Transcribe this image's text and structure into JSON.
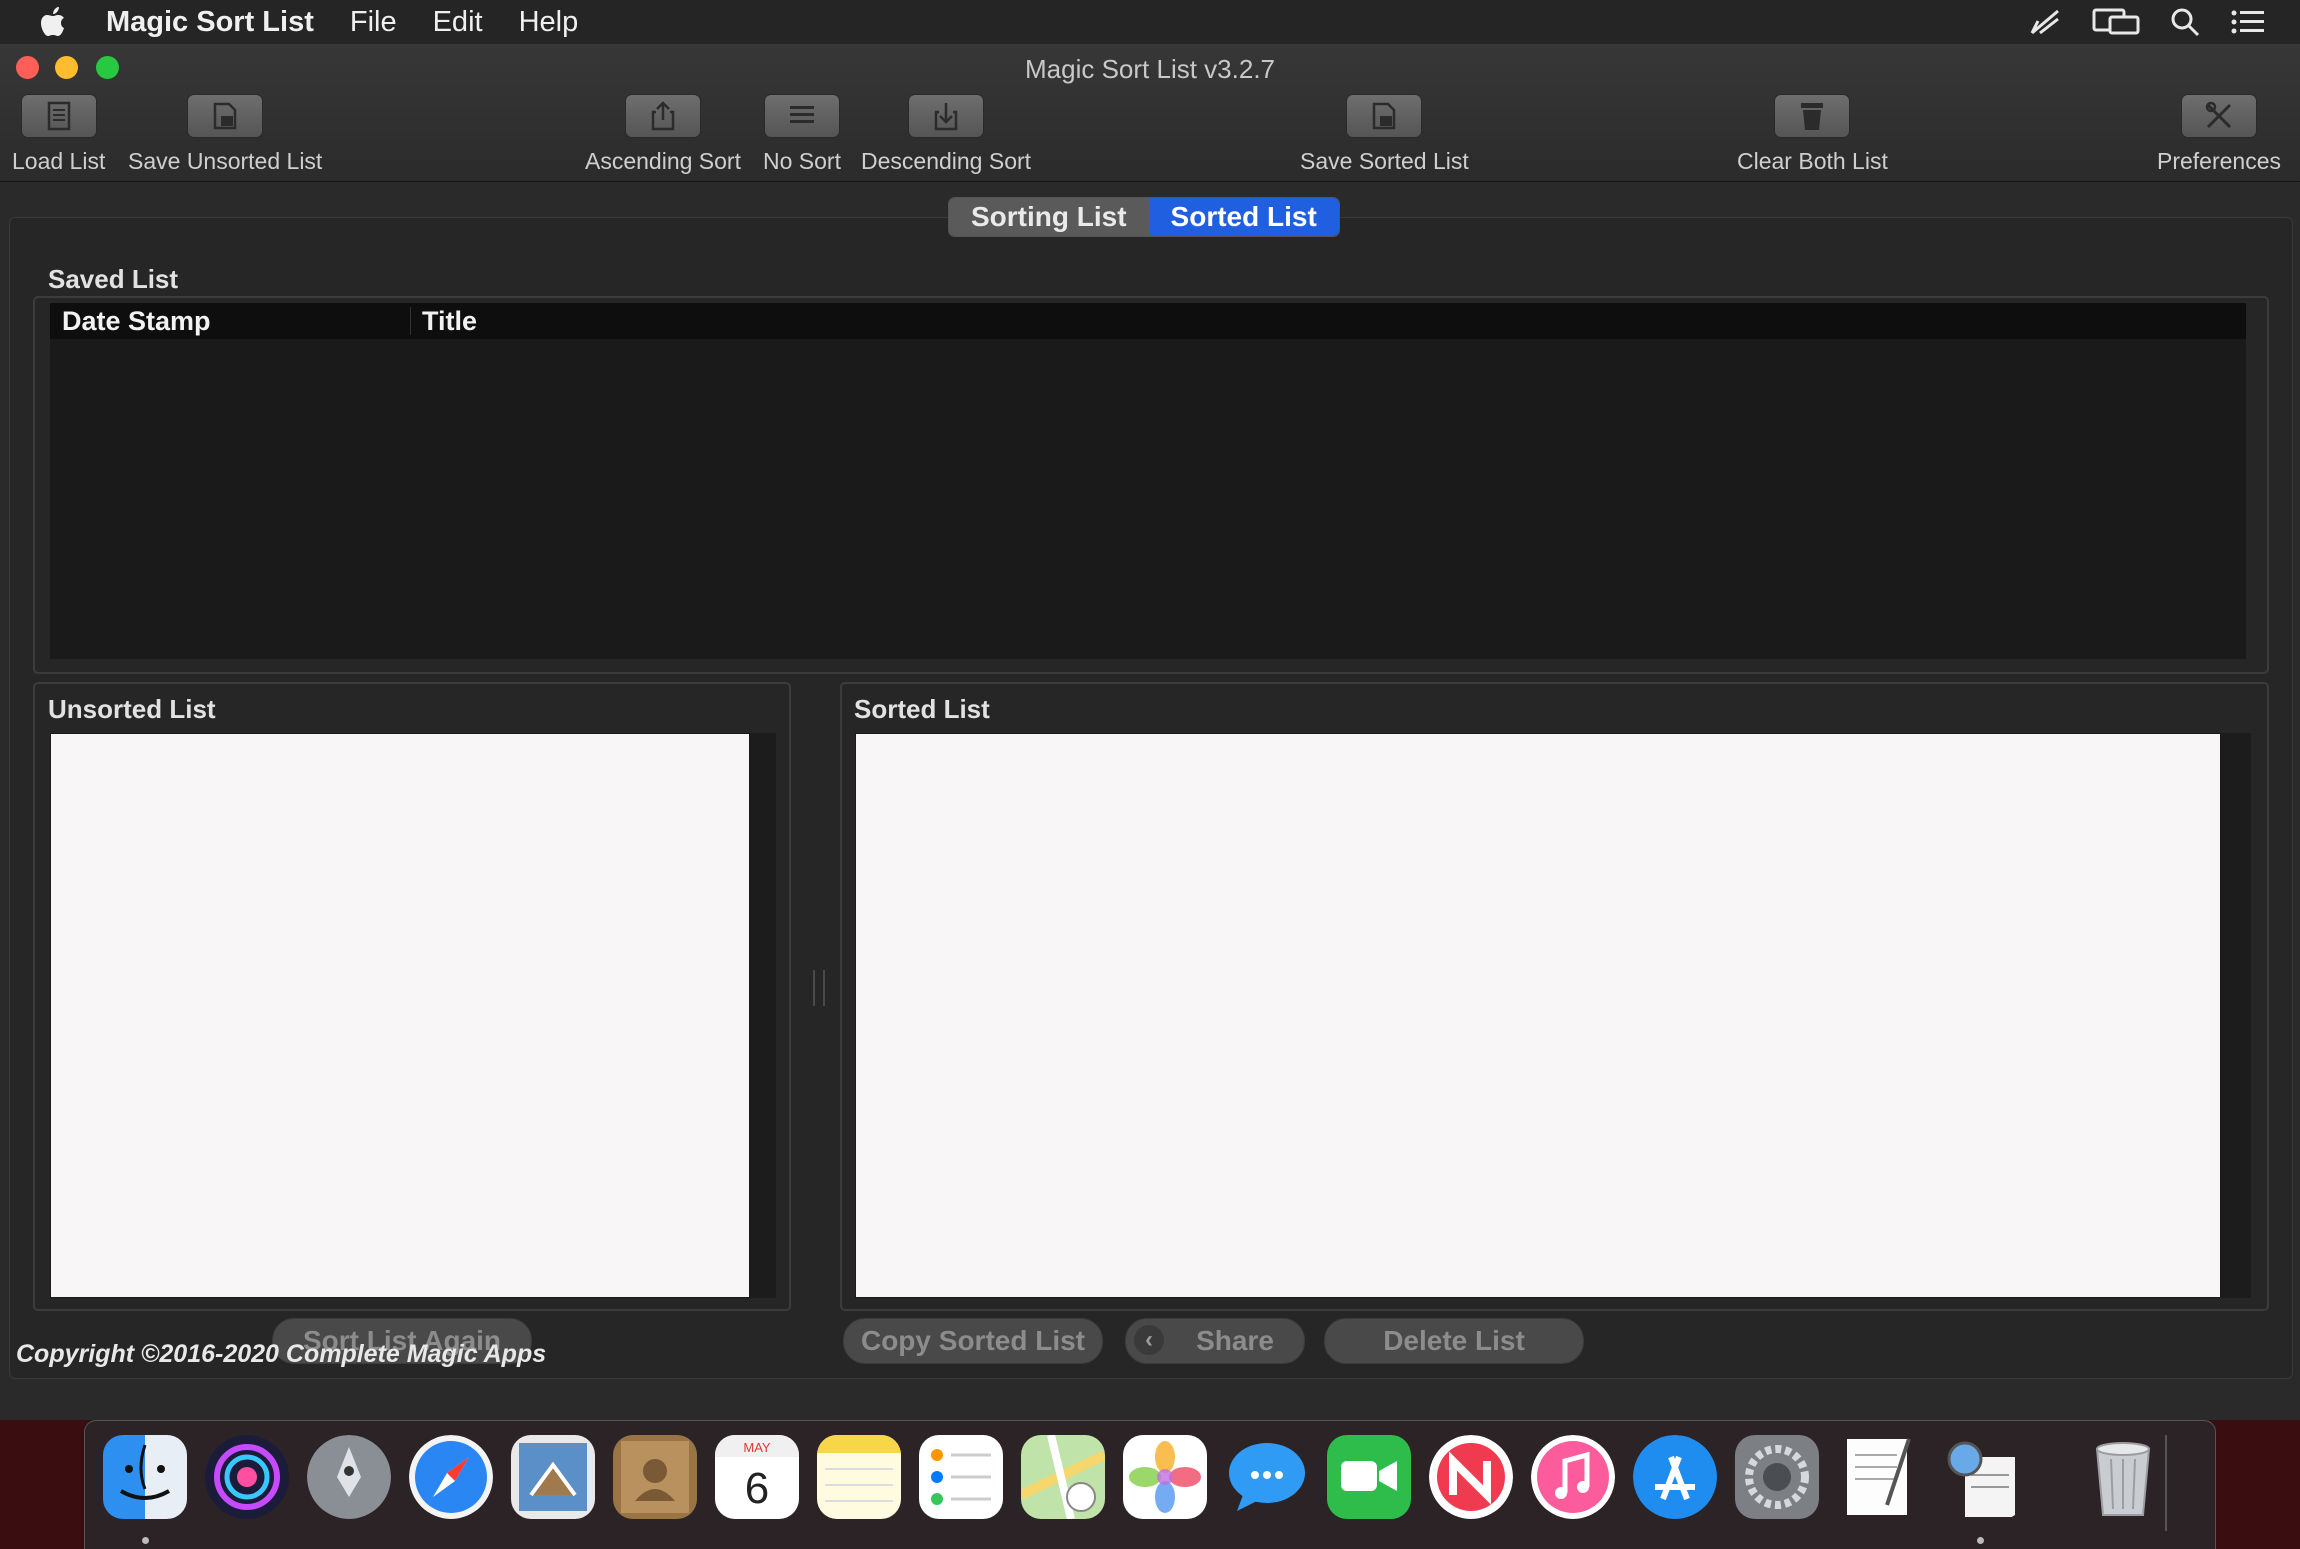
{
  "menubar": {
    "app_name": "Magic Sort List",
    "menus": [
      "File",
      "Edit",
      "Help"
    ],
    "status_icons": [
      "cast-icon",
      "display-mirror-icon",
      "spotlight-search-icon",
      "notification-center-icon"
    ]
  },
  "window": {
    "title": "Magic Sort List v3.2.7",
    "toolbar": {
      "load": "Load List",
      "save_unsorted": "Save Unsorted List",
      "ascending": "Ascending Sort",
      "no_sort": "No Sort",
      "descending": "Descending Sort",
      "save_sorted": "Save Sorted List",
      "clear_both": "Clear Both List",
      "preferences": "Preferences"
    },
    "segments": {
      "sorting": "Sorting List",
      "sorted": "Sorted List",
      "selected": "Sorted List"
    },
    "saved_list": {
      "label": "Saved List",
      "columns": [
        "Date Stamp",
        "Title"
      ],
      "rows": []
    },
    "unsorted": {
      "label": "Unsorted List",
      "content": ""
    },
    "sorted": {
      "label": "Sorted List",
      "content": ""
    },
    "buttons": {
      "sort_again": "Sort List Again",
      "copy_sorted": "Copy Sorted List",
      "share": "Share",
      "delete": "Delete List"
    },
    "copyright": "Copyright ©2016-2020 Complete Magic Apps"
  },
  "dock": {
    "calendar_month": "MAY",
    "calendar_day": "6",
    "apps": [
      "Finder",
      "Siri",
      "Launchpad",
      "Safari",
      "Mail",
      "Contacts",
      "Calendar",
      "Notes",
      "Reminders",
      "Maps",
      "Photos",
      "Messages",
      "FaceTime",
      "News",
      "iTunes",
      "App Store",
      "System Preferences",
      "TextEdit",
      "Preview",
      "Trash"
    ]
  },
  "colors": {
    "segment_selected": "#1f5fe0",
    "close": "#ff5f57",
    "minimize": "#febc2e",
    "zoom": "#28c840"
  }
}
